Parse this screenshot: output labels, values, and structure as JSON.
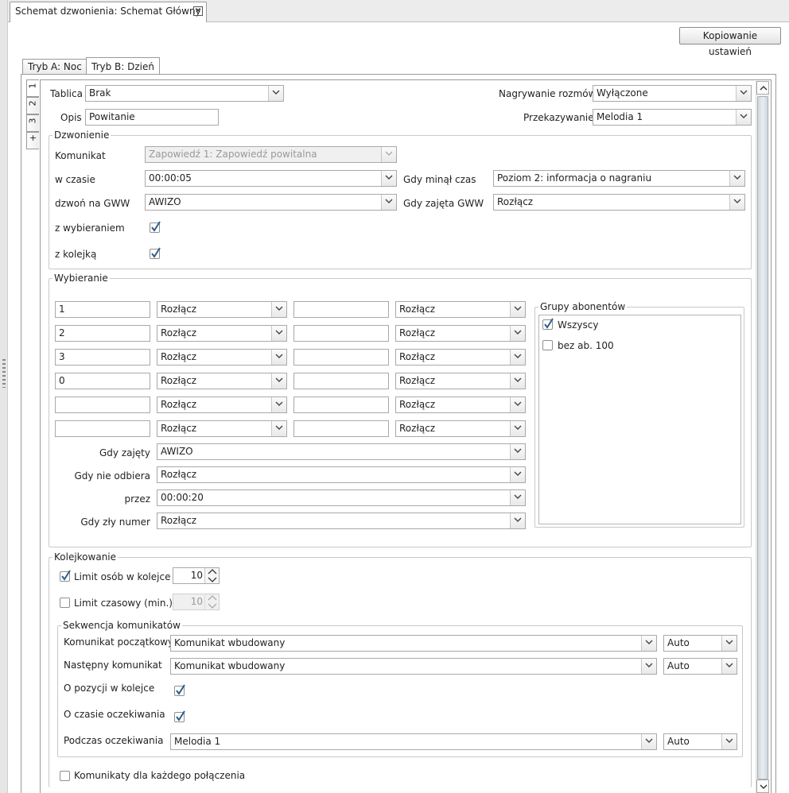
{
  "window": {
    "doc_tab": "Schemat dzwonienia: Schemat Główny",
    "copy_button": "Kopiowanie ustawień"
  },
  "mode_tabs": [
    {
      "label": "Tryb A: Noc",
      "active": false
    },
    {
      "label": "Tryb B: Dzień",
      "active": true
    }
  ],
  "side_tabs": [
    "1",
    "2",
    "3",
    "+"
  ],
  "header": {
    "tablica_label": "Tablica",
    "tablica_value": "Brak",
    "opis_label": "Opis",
    "opis_value": "Powitanie",
    "nagrywanie_label": "Nagrywanie rozmów",
    "nagrywanie_value": "Wyłączone",
    "przekazywanie_label": "Przekazywanie",
    "przekazywanie_value": "Melodia 1"
  },
  "dzwonienie": {
    "title": "Dzwonienie",
    "komunikat_label": "Komunikat",
    "komunikat_value": "Zapowiedź 1: Zapowiedź powitalna",
    "w_czasie_label": "w czasie",
    "w_czasie_value": "00:00:05",
    "gdy_minal_label": "Gdy minął czas",
    "gdy_minal_value": "Poziom 2: informacja o nagraniu",
    "dzwon_label": "dzwoń na GWW",
    "dzwon_value": "AWIZO",
    "gdy_zajeta_label": "Gdy zajęta GWW",
    "gdy_zajeta_value": "Rozłącz",
    "z_wybieraniem_label": "z wybieraniem",
    "z_wybieraniem_checked": true,
    "z_kolejka_label": "z kolejką",
    "z_kolejka_checked": true
  },
  "wybieranie": {
    "title": "Wybieranie",
    "rows": [
      {
        "key1": "1",
        "action1": "Rozłącz",
        "key2": "",
        "action2": "Rozłącz"
      },
      {
        "key1": "2",
        "action1": "Rozłącz",
        "key2": "",
        "action2": "Rozłącz"
      },
      {
        "key1": "3",
        "action1": "Rozłącz",
        "key2": "",
        "action2": "Rozłącz"
      },
      {
        "key1": "0",
        "action1": "Rozłącz",
        "key2": "",
        "action2": "Rozłącz"
      },
      {
        "key1": "",
        "action1": "Rozłącz",
        "key2": "",
        "action2": "Rozłącz"
      },
      {
        "key1": "",
        "action1": "Rozłącz",
        "key2": "",
        "action2": "Rozłącz"
      }
    ],
    "gdy_zajety_label": "Gdy zajęty",
    "gdy_zajety_value": "AWIZO",
    "gdy_nie_odbiera_label": "Gdy nie odbiera",
    "gdy_nie_odbiera_value": "Rozłącz",
    "przez_label": "przez",
    "przez_value": "00:00:20",
    "gdy_zly_label": "Gdy zły numer",
    "gdy_zly_value": "Rozłącz",
    "grupy": {
      "title": "Grupy abonentów",
      "items": [
        {
          "label": "Wszyscy",
          "checked": true
        },
        {
          "label": "bez ab. 100",
          "checked": false
        }
      ]
    }
  },
  "kolejkowanie": {
    "title": "Kolejkowanie",
    "limit_osob_label": "Limit osób w kolejce",
    "limit_osob_checked": true,
    "limit_osob_value": "10",
    "limit_czas_label": "Limit czasowy (min.)",
    "limit_czas_checked": false,
    "limit_czas_value": "10",
    "sekwencja": {
      "title": "Sekwencja komunikatów",
      "poczatkowy_label": "Komunikat początkowy",
      "poczatkowy_value": "Komunikat wbudowany",
      "poczatkowy_mode": "Auto",
      "nastepny_label": "Następny komunikat",
      "nastepny_value": "Komunikat wbudowany",
      "nastepny_mode": "Auto",
      "pozycja_label": "O pozycji w kolejce",
      "pozycja_checked": true,
      "czas_label": "O czasie oczekiwania",
      "czas_checked": true,
      "podczas_label": "Podczas oczekiwania",
      "podczas_value": "Melodia 1",
      "podczas_mode": "Auto"
    },
    "kazde_label": "Komunikaty dla każdego połączenia",
    "kazde_checked": false
  }
}
